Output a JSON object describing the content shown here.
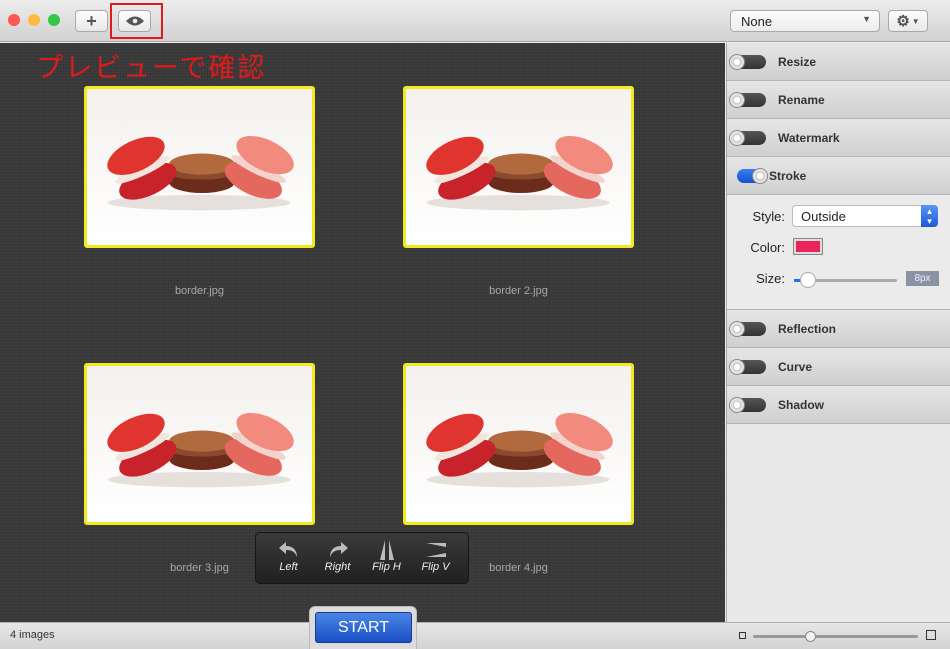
{
  "window": {
    "preset_select": "None",
    "annotation": "プレビューで確認"
  },
  "images": [
    {
      "name": "border.jpg"
    },
    {
      "name": "border 2.jpg"
    },
    {
      "name": "border 3.jpg"
    },
    {
      "name": "border 4.jpg"
    }
  ],
  "toolbar": {
    "left": "Left",
    "right": "Right",
    "flip_h": "Flip H",
    "flip_v": "Flip V"
  },
  "start_label": "START",
  "status": "4 images",
  "sidebar": {
    "items": [
      {
        "label": "Resize",
        "on": false
      },
      {
        "label": "Rename",
        "on": false
      },
      {
        "label": "Watermark",
        "on": false
      },
      {
        "label": "Stroke",
        "on": true
      },
      {
        "label": "Reflection",
        "on": false
      },
      {
        "label": "Curve",
        "on": false
      },
      {
        "label": "Shadow",
        "on": false
      }
    ],
    "stroke": {
      "style_label": "Style:",
      "style_value": "Outside",
      "color_label": "Color:",
      "color": "#e8245a",
      "size_label": "Size:",
      "size_value": "8px",
      "size_fraction": 0.08
    }
  },
  "colors": {
    "border": "#f1ea1c",
    "accent": "#1a55d0"
  }
}
